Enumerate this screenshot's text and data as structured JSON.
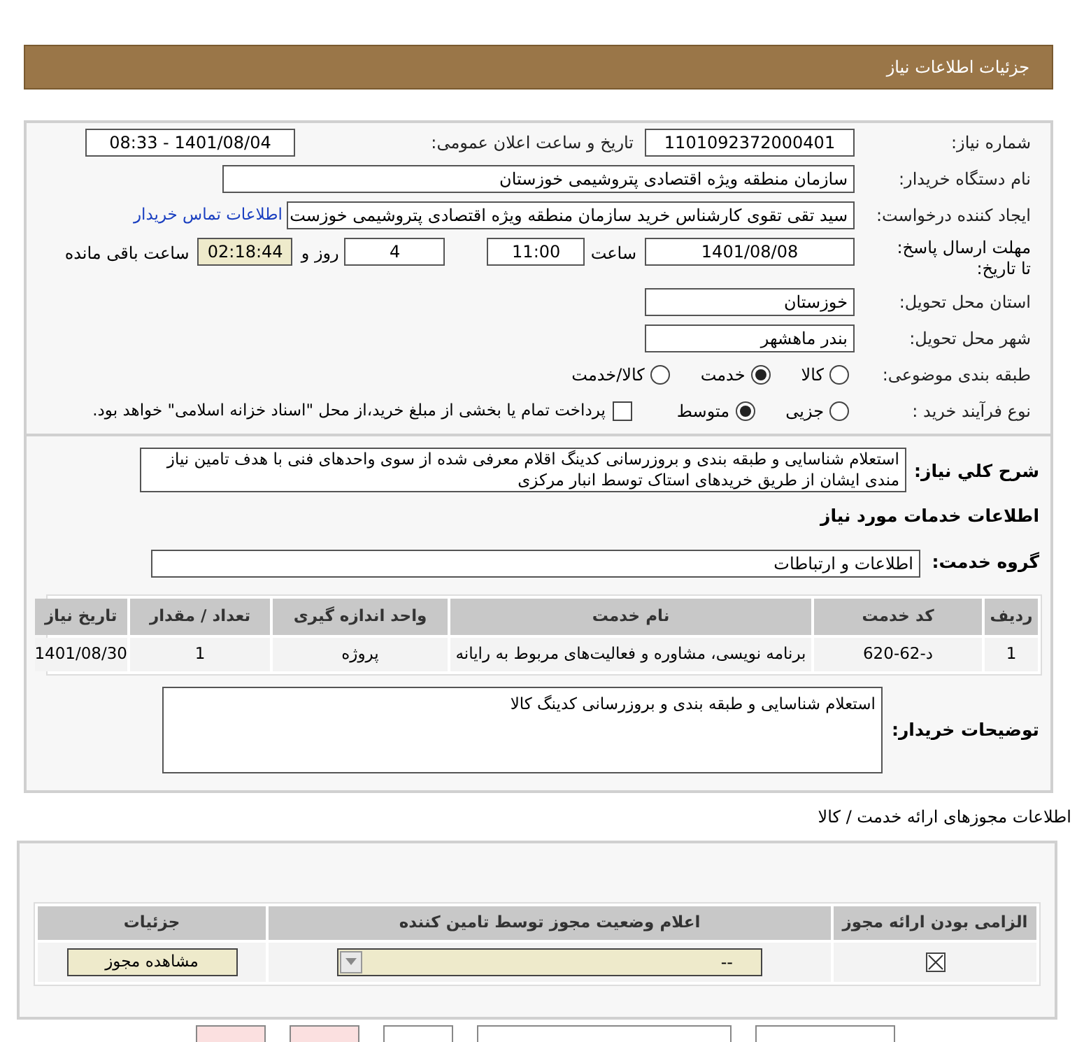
{
  "header": {
    "title": "جزئیات اطلاعات نیاز"
  },
  "need_info": {
    "need_number": {
      "label": "شماره نیاز:",
      "value": "1101092372000401"
    },
    "announce_datetime": {
      "label": "تاریخ و ساعت اعلان عمومی:",
      "value": "1401/08/04 - 08:33"
    },
    "buyer_org": {
      "label": "نام دستگاه خریدار:",
      "value": "سازمان منطقه ویژه اقتصادی پتروشیمی خوزستان"
    },
    "requester": {
      "label": "ایجاد کننده درخواست:",
      "value": "سید تقی تقوی کارشناس خرید سازمان منطقه ویژه اقتصادی پتروشیمی خوزست",
      "link": "اطلاعات تماس خریدار"
    },
    "deadline": {
      "label": "مهلت ارسال پاسخ: تا تاریخ:",
      "date": "1401/08/08",
      "time_label": "ساعت",
      "time": "11:00",
      "days": "4",
      "days_label": "روز و",
      "remaining": "02:18:44",
      "remaining_label": "ساعت باقی مانده"
    },
    "province": {
      "label": "استان محل تحویل:",
      "value": "خوزستان"
    },
    "city": {
      "label": "شهر محل تحویل:",
      "value": "بندر ماهشهر"
    },
    "category": {
      "label": "طبقه بندی موضوعی:",
      "options": [
        {
          "label": "کالا",
          "selected": false
        },
        {
          "label": "خدمت",
          "selected": true
        },
        {
          "label": "کالا/خدمت",
          "selected": false
        }
      ]
    },
    "purchase_process": {
      "label": "نوع فرآیند خرید :",
      "options": [
        {
          "label": "جزیی",
          "selected": false
        },
        {
          "label": "متوسط",
          "selected": true
        }
      ],
      "payment": {
        "checked": false,
        "label": "پرداخت تمام یا بخشی از مبلغ خرید،از محل \"اسناد خزانه اسلامی\" خواهد بود."
      }
    }
  },
  "services": {
    "description_label": "شرح کلي نياز:",
    "description": "استعلام شناسایی و طبقه بندی و بروزرسانی کدینگ اقلام معرفی شده از سوی واحدهای فنی با هدف تامین نیاز مندی ایشان از طریق خریدهای استاک توسط انبار مرکزی",
    "section_title": "اطلاعات خدمات مورد نیاز",
    "group_label": "گروه خدمت:",
    "group_value": "اطلاعات و ارتباطات",
    "table": {
      "columns": [
        "ردیف",
        "کد خدمت",
        "نام خدمت",
        "واحد اندازه گیری",
        "تعداد / مقدار",
        "تاریخ نیاز"
      ],
      "rows": [
        [
          "1",
          "د-62-620",
          "برنامه نویسی، مشاوره و فعالیت‌های مربوط به رایانه",
          "پروژه",
          "1",
          "1401/08/30"
        ]
      ]
    },
    "buyer_notes_label": "توضیحات خریدار:",
    "buyer_notes": "استعلام شناسایی و طبقه بندی و بروزرسانی کدینگ کالا"
  },
  "permits": {
    "title": "اطلاعات مجوزهای ارائه خدمت / کالا",
    "columns": [
      "الزامی بودن ارائه مجوز",
      "اعلام وضعیت مجوز توسط تامین کننده",
      "جزئیات"
    ],
    "rows": [
      {
        "required": true,
        "status": "--",
        "button": "مشاهده مجوز"
      }
    ]
  }
}
